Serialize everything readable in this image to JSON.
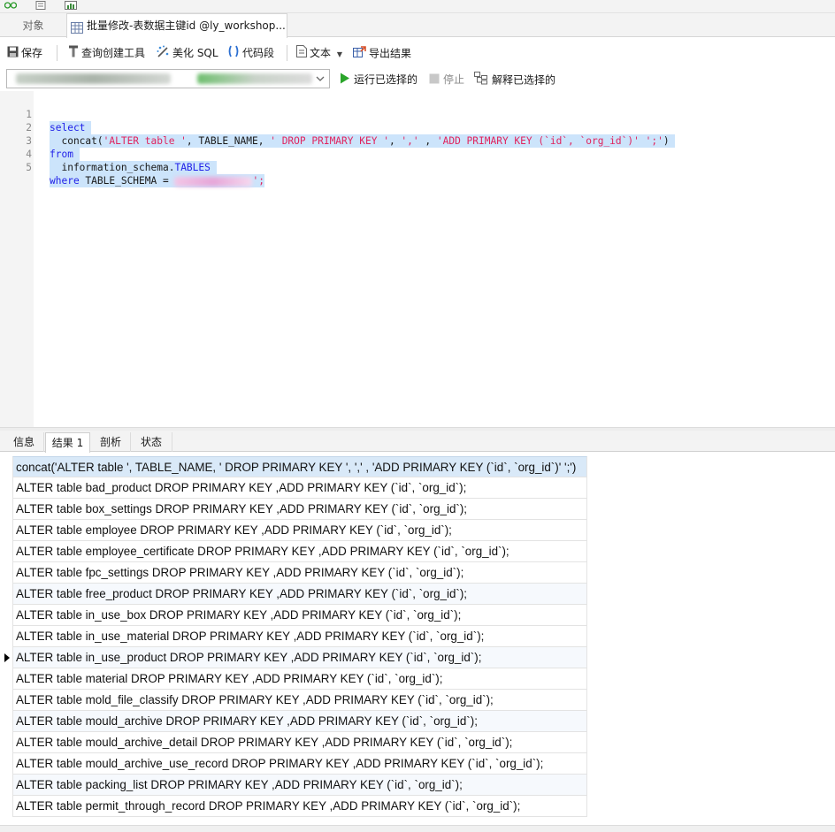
{
  "tabs": {
    "objects_label": "对象",
    "query_label": "批量修改-表数据主键id @ly_workshop..."
  },
  "toolbar": {
    "save": "保存",
    "query_builder": "查询创建工具",
    "beautify": "美化 SQL",
    "snippet": "代码段",
    "text": "文本",
    "export": "导出结果"
  },
  "connbar": {
    "run_selected": "运行已选择的",
    "stop": "停止",
    "explain_selected": "解释已选择的"
  },
  "editor": {
    "line_numbers": [
      "1",
      "2",
      "3",
      "4",
      "5"
    ],
    "l1_kw": "select",
    "l2_fn": "  concat(",
    "l2_s1": "'ALTER table '",
    "l2_t1": ", TABLE_NAME, ",
    "l2_s2": "' DROP PRIMARY KEY '",
    "l2_t2": ", ",
    "l2_s3": "','",
    "l2_t3": " , ",
    "l2_s4": "'ADD PRIMARY KEY (`id`, `org_id`)' ';'",
    "l2_t4": ")",
    "l3_kw": "from",
    "l4_a": "  information_schema.",
    "l4_b": "TABLES",
    "l5_kw": "where",
    "l5_t": " TABLE_SCHEMA = ",
    "l5_end": "';"
  },
  "result_tabs": [
    "信息",
    "结果 1",
    "剖析",
    "状态"
  ],
  "grid": {
    "header": "concat('ALTER table ', TABLE_NAME, ' DROP PRIMARY KEY ', ',' , 'ADD PRIMARY KEY (`id`, `org_id`)' ';')",
    "rows": [
      "ALTER table bad_product DROP PRIMARY KEY ,ADD PRIMARY KEY (`id`, `org_id`);",
      "ALTER table box_settings DROP PRIMARY KEY ,ADD PRIMARY KEY (`id`, `org_id`);",
      "ALTER table employee DROP PRIMARY KEY ,ADD PRIMARY KEY (`id`, `org_id`);",
      "ALTER table employee_certificate DROP PRIMARY KEY ,ADD PRIMARY KEY (`id`, `org_id`);",
      "ALTER table fpc_settings DROP PRIMARY KEY ,ADD PRIMARY KEY (`id`, `org_id`);",
      "ALTER table free_product DROP PRIMARY KEY ,ADD PRIMARY KEY (`id`, `org_id`);",
      "ALTER table in_use_box DROP PRIMARY KEY ,ADD PRIMARY KEY (`id`, `org_id`);",
      "ALTER table in_use_material DROP PRIMARY KEY ,ADD PRIMARY KEY (`id`, `org_id`);",
      "ALTER table in_use_product DROP PRIMARY KEY ,ADD PRIMARY KEY (`id`, `org_id`);",
      "ALTER table material DROP PRIMARY KEY ,ADD PRIMARY KEY (`id`, `org_id`);",
      "ALTER table mold_file_classify DROP PRIMARY KEY ,ADD PRIMARY KEY (`id`, `org_id`);",
      "ALTER table mould_archive DROP PRIMARY KEY ,ADD PRIMARY KEY (`id`, `org_id`);",
      "ALTER table mould_archive_detail DROP PRIMARY KEY ,ADD PRIMARY KEY (`id`, `org_id`);",
      "ALTER table mould_archive_use_record DROP PRIMARY KEY ,ADD PRIMARY KEY (`id`, `org_id`);",
      "ALTER table packing_list DROP PRIMARY KEY ,ADD PRIMARY KEY (`id`, `org_id`);",
      "ALTER table permit_through_record DROP PRIMARY KEY ,ADD PRIMARY KEY (`id`, `org_id`);"
    ]
  },
  "colors": {
    "selection": "#cce4fb",
    "keyword": "#2222e8",
    "string": "#e0245e",
    "grid_header": "#d9e9f8",
    "run_green": "#2aa52a"
  },
  "icons": [
    "tab-table-icon",
    "save-icon",
    "query-builder-icon",
    "beautify-icon",
    "snippet-icon",
    "text-icon",
    "export-icon",
    "run-icon",
    "stop-icon",
    "explain-icon",
    "row-pointer-icon"
  ]
}
